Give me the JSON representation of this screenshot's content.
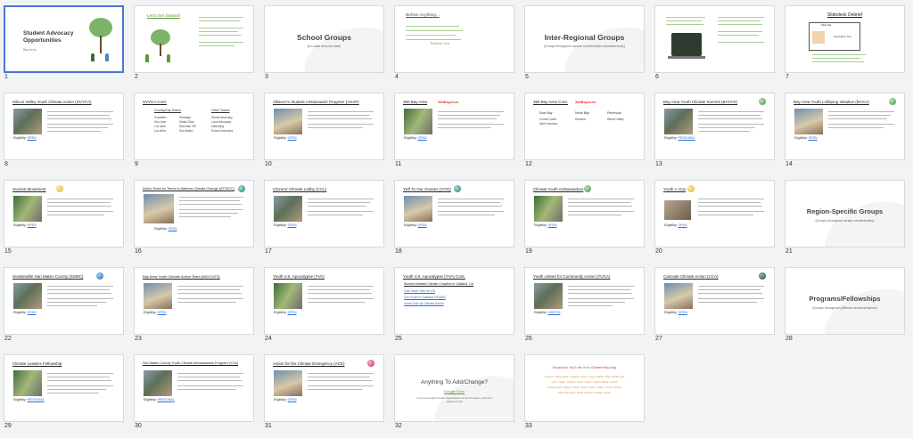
{
  "slides": [
    {
      "num": "1",
      "title": "Student Advocacy Opportunities",
      "subtitle": "Bay Area"
    },
    {
      "num": "2",
      "title": "Let's Get Started!"
    },
    {
      "num": "3",
      "title": "School Groups",
      "subtitle": "(Ex-class relaunch date)"
    },
    {
      "num": "4",
      "title": "Before Anything...",
      "note": "Email us, Lexi"
    },
    {
      "num": "5",
      "title": "Inter-Regional Groups",
      "subtitle": "(Groups throughout various counties/cities simultaneously)"
    },
    {
      "num": "6"
    },
    {
      "num": "7",
      "title": "Slidedeck Debrief",
      "labels": [
        "Slide title",
        "Description Text"
      ]
    },
    {
      "num": "8",
      "title": "Silicon Valley Youth Climate Action (SVYCA)",
      "elig": "Eligibility:",
      "elig_link": "OPEN"
    },
    {
      "num": "9",
      "title": "SVYCA Cont.",
      "head_left": "County/City Teams",
      "head_right": "Other Teams",
      "left_col1": [
        "Cupertino",
        "San Jose",
        "Los Altos",
        "Los Altos"
      ],
      "left_col2": [
        "Saratoga",
        "Santa Clara",
        "Mountain VIE",
        "San Mateo"
      ],
      "right_col": [
        "Global Advocacy",
        "Local Advocacy",
        "Marketing",
        "School Advocacy"
      ]
    },
    {
      "num": "10",
      "title": "Alliance's Student Ambassador Program (ASAP)",
      "elig": "Eligibility:",
      "elig_link": "OPEN"
    },
    {
      "num": "11",
      "title": "350 Bay Area",
      "logo": "350BayArea",
      "elig": "Eligibility:",
      "elig_link": "OPEN"
    },
    {
      "num": "12",
      "title": "350 Bay Area Cont.",
      "logo": "350BayArea",
      "col1_head": "East Bay",
      "col1": [
        "Contra Costa",
        "San Francisco"
      ],
      "col2_head": "North Bay",
      "col2": [
        "Sonoma"
      ],
      "col3_head": "Peninsula",
      "col3": [
        "Silicon Valley"
      ]
    },
    {
      "num": "13",
      "title": "Bay Area Youth Climate Summit (BAYCS)",
      "elig": "Eligibility:",
      "elig_link": "PERSONAL"
    },
    {
      "num": "14",
      "title": "Bay Area Youth Lobbying Initiative (BAYLI)",
      "elig": "Eligibility:",
      "elig_link": "OPEN"
    },
    {
      "num": "15",
      "title": "Sunrise Movement",
      "elig": "Eligibility:",
      "elig_link": "OPEN"
    },
    {
      "num": "16",
      "title": "Action Team for Teens to Address Climate Change (ATTACC)",
      "elig": "Eligibility:",
      "elig_link": "OPEN"
    },
    {
      "num": "17",
      "title": "Citizens' Climate Lobby (CCL)",
      "elig": "Eligibility:",
      "elig_link": "OPEN"
    },
    {
      "num": "18",
      "title": "Ya'll To Our Oceans (YOO)",
      "elig": "Eligibility:",
      "elig_link": "OPEN"
    },
    {
      "num": "19",
      "title": "Climate Youth Ambassadors",
      "elig": "Eligibility:",
      "elig_link": "OPEN"
    },
    {
      "num": "20",
      "title": "Youth v. Gov",
      "elig": "Eligibility:",
      "elig_link": "OPEN"
    },
    {
      "num": "21",
      "title": "Region-Specific Groups",
      "subtitle": "(Groups throughout certain counties/cities)"
    },
    {
      "num": "22",
      "title": "Sustainable San Mateo County (SSMC)",
      "elig": "Eligibility:",
      "elig_link": "OPEN"
    },
    {
      "num": "23",
      "title": "Bay Area Youth Climate Action Team (BAYCATS)",
      "elig": "Eligibility:",
      "elig_link": "OPEN"
    },
    {
      "num": "24",
      "title": "Youth V.S. Apocalypse (YVA)",
      "elig": "Eligibility:",
      "elig_link": "OPEN"
    },
    {
      "num": "25",
      "title": "Youth V.S. Apocalypse (YVA) Cont.",
      "lead": "Student-Initiated Climate Chapters in Oakland, CA",
      "links": [
        "Oak Youth Vote for US",
        "Our Youth in Oakland ROADS",
        "Youth Vote @ Climate Action"
      ]
    },
    {
      "num": "26",
      "title": "Youth United for Community Action (YUCA)",
      "elig": "Eligibility:",
      "elig_link": "LIMITED"
    },
    {
      "num": "27",
      "title": "Cascade Climate Action (CCA)",
      "elig": "Eligibility:",
      "elig_link": "OPEN"
    },
    {
      "num": "28",
      "title": "Programs/Fellowships",
      "subtitle": "(Groups throughout (different seasons/regions)"
    },
    {
      "num": "29",
      "title": "Climate Leaders Fellowship",
      "elig": "Eligibility:",
      "elig_link": "PERSONAL"
    },
    {
      "num": "30",
      "title": "San Mateo County Youth Climate Ambassadors Program (YCA)",
      "elig": "Eligibility:",
      "elig_link": "PERSONAL"
    },
    {
      "num": "31",
      "title": "Action for the Climate Emergency (ACE)",
      "elig": "Eligibility:",
      "elig_link": "OPEN"
    },
    {
      "num": "32",
      "title": "Anything To Add/Change?",
      "link": "Google Form",
      "sub": "Let us know about similar organizations via the link above, and we'll update our list!"
    },
    {
      "num": "33",
      "title_pre": "Shoutout to You & the",
      "title_mid": "Youth",
      "title_post": "Climate Policy Bay",
      "lines": [
        "Lindsey • Nora • Eliya • Juliana • Annie • Fina • Wahid • Rita • Addie Hunt",
        "Lynn • Sage • Ocean • Tarrin • Lettie • Noah • Maria • Laurel",
        "Ashley Lewis • Maya • Oliver • Rosa • Chris • Baker • Emily • Nicole",
        "Nicole Bevana • Sylvia • Emma • Daniel • Aaron"
      ]
    }
  ]
}
